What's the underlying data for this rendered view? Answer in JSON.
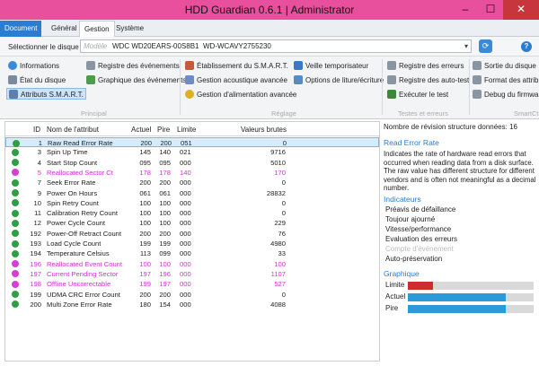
{
  "window": {
    "title": "HDD Guardian 0.6.1 | Administrator",
    "min": "–",
    "max": "☐",
    "close": "✕"
  },
  "tabs": [
    "Document",
    "Général",
    "Gestion",
    "Système"
  ],
  "disk": {
    "label": "Sélectionner le disque",
    "placeholder": "Modèle",
    "model": "WDC WD20EARS-00S8B1",
    "serial": "WD-WCAVY2755230",
    "arrow": "▾",
    "refresh": "⟳",
    "help": "?"
  },
  "ribbon": {
    "groups": [
      "Principal",
      "Réglage",
      "Testes et erreurs",
      "SmartCt"
    ],
    "items": [
      {
        "label": "Informations",
        "icon": "info-icon",
        "color": "#3b8ad8"
      },
      {
        "label": "État du disque",
        "icon": "disk-status-icon",
        "color": "#7a8ba0"
      },
      {
        "label": "Attributs S.M.A.R.T.",
        "icon": "smart-attributes-icon",
        "color": "#5a7fb0"
      },
      {
        "label": "Registre des événements",
        "icon": "event-log-icon",
        "color": "#8a95a3"
      },
      {
        "label": "Graphique des événements",
        "icon": "events-chart-icon",
        "color": "#4e9a4e"
      },
      {
        "label": "Établissement du S.M.A.R.T.",
        "icon": "smart-setup-icon",
        "color": "#c45a3a"
      },
      {
        "label": "Gestion acoustique avancée",
        "icon": "acoustic-icon",
        "color": "#6b8cc4"
      },
      {
        "label": "Gestion d'alimentation avancée",
        "icon": "power-icon",
        "color": "#e0b020"
      },
      {
        "label": "Veille temporisateur",
        "icon": "standby-timer-icon",
        "color": "#3a7ac4"
      },
      {
        "label": "Options de liture/écriture",
        "icon": "read-write-icon",
        "color": "#5a8ac4"
      },
      {
        "label": "Registre des erreurs",
        "icon": "error-log-icon",
        "color": "#8a95a3"
      },
      {
        "label": "Registre des auto-test",
        "icon": "selftest-log-icon",
        "color": "#8a95a3"
      },
      {
        "label": "Exécuter le test",
        "icon": "run-test-icon",
        "color": "#3a8a3a"
      },
      {
        "label": "Sortie du disque",
        "icon": "disk-output-icon",
        "color": "#8a95a3"
      },
      {
        "label": "Format des attrib",
        "icon": "attribute-format-icon",
        "color": "#8a95a3"
      },
      {
        "label": "Debug du firmwa",
        "icon": "firmware-debug-icon",
        "color": "#8a95a3"
      }
    ]
  },
  "table": {
    "headers": [
      "ID",
      "Nom de l'attribut",
      "Actuel",
      "Pire",
      "Limite",
      "Valeurs brutes"
    ],
    "rows": [
      {
        "id": "1",
        "name": "Raw Read Error Rate",
        "actuel": "200",
        "pire": "200",
        "limite": "051",
        "brut": "0",
        "status": "ok"
      },
      {
        "id": "3",
        "name": "Spin Up Time",
        "actuel": "145",
        "pire": "140",
        "limite": "021",
        "brut": "9716",
        "status": "ok"
      },
      {
        "id": "4",
        "name": "Start Stop Count",
        "actuel": "095",
        "pire": "095",
        "limite": "000",
        "brut": "5010",
        "status": "ok"
      },
      {
        "id": "5",
        "name": "Reallocated Sector Ct",
        "actuel": "178",
        "pire": "178",
        "limite": "140",
        "brut": "170",
        "status": "warn"
      },
      {
        "id": "7",
        "name": "Seek Error Rate",
        "actuel": "200",
        "pire": "200",
        "limite": "000",
        "brut": "0",
        "status": "ok"
      },
      {
        "id": "9",
        "name": "Power On Hours",
        "actuel": "061",
        "pire": "061",
        "limite": "000",
        "brut": "28832",
        "status": "ok"
      },
      {
        "id": "10",
        "name": "Spin Retry Count",
        "actuel": "100",
        "pire": "100",
        "limite": "000",
        "brut": "0",
        "status": "ok"
      },
      {
        "id": "11",
        "name": "Calibration Retry Count",
        "actuel": "100",
        "pire": "100",
        "limite": "000",
        "brut": "0",
        "status": "ok"
      },
      {
        "id": "12",
        "name": "Power Cycle Count",
        "actuel": "100",
        "pire": "100",
        "limite": "000",
        "brut": "229",
        "status": "ok"
      },
      {
        "id": "192",
        "name": "Power-Off Retract Count",
        "actuel": "200",
        "pire": "200",
        "limite": "000",
        "brut": "76",
        "status": "ok"
      },
      {
        "id": "193",
        "name": "Load Cycle Count",
        "actuel": "199",
        "pire": "199",
        "limite": "000",
        "brut": "4980",
        "status": "ok"
      },
      {
        "id": "194",
        "name": "Temperature Celsius",
        "actuel": "113",
        "pire": "099",
        "limite": "000",
        "brut": "33",
        "status": "ok"
      },
      {
        "id": "196",
        "name": "Reallocated Event Count",
        "actuel": "100",
        "pire": "100",
        "limite": "000",
        "brut": "100",
        "status": "warn"
      },
      {
        "id": "197",
        "name": "Current Pending Sector",
        "actuel": "197",
        "pire": "196",
        "limite": "000",
        "brut": "1107",
        "status": "warn"
      },
      {
        "id": "198",
        "name": "Offline Uncorrectable",
        "actuel": "199",
        "pire": "197",
        "limite": "000",
        "brut": "527",
        "status": "warn"
      },
      {
        "id": "199",
        "name": "UDMA CRC Error Count",
        "actuel": "200",
        "pire": "200",
        "limite": "000",
        "brut": "0",
        "status": "ok"
      },
      {
        "id": "200",
        "name": "Multi Zone Error Rate",
        "actuel": "180",
        "pire": "154",
        "limite": "000",
        "brut": "4088",
        "status": "ok"
      }
    ]
  },
  "colors": {
    "ok_dot": "#2ea043",
    "warn_dot": "#d43fd4",
    "warn_text": "#cc33cc",
    "limit_bar": "#d12c2c",
    "value_bar": "#2b9ad8",
    "accent": "#2b7cd3"
  },
  "details": {
    "revision_label": "Nombre de révision structure données: 16",
    "attr_title": "Read Error Rate",
    "description": "Indicates the rate of hardware read errors that occurred when reading data from a disk surface. The raw value has different structure for different vendors and is often not meaningful as a decimal number.",
    "indicators_title": "Indicateurs",
    "indicators": [
      {
        "label": "Préavis de défaillance",
        "active": true
      },
      {
        "label": "Toujour ajourné",
        "active": true
      },
      {
        "label": "Vitesse/performance",
        "active": true
      },
      {
        "label": "Evaluation des erreurs",
        "active": true
      },
      {
        "label": "Compte d'événement",
        "active": false
      },
      {
        "label": "Auto-préservation",
        "active": true
      }
    ],
    "graph_title": "Graphique",
    "graph": [
      {
        "label": "Limite",
        "fraction": 0.2
      },
      {
        "label": "Actuel",
        "fraction": 0.78
      },
      {
        "label": "Pire",
        "fraction": 0.78
      }
    ]
  }
}
